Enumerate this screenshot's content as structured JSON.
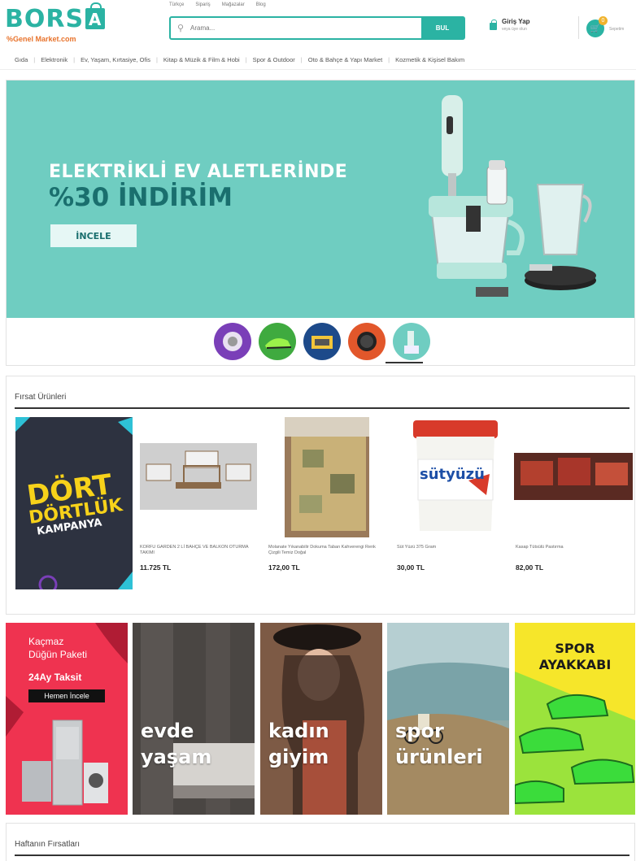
{
  "header": {
    "logo_text": "BORS",
    "logo_bag_letter": "A",
    "logo_sub": "%Genel Market.com",
    "toplinks": [
      "Türkçe",
      "Sipariş",
      "Mağazalar",
      "Blog"
    ],
    "search_placeholder": "Arama...",
    "search_button": "BUL",
    "login_main": "Giriş Yap",
    "login_sub": "veya üye olun",
    "cart_badge": "0",
    "cart_label": "Sepetim"
  },
  "nav": {
    "items": [
      "Gıda",
      "Elektronik",
      "Ev, Yaşam, Kırtasiye, Ofis",
      "Kitap & Müzik & Film & Hobi",
      "Spor & Outdoor",
      "Oto & Bahçe & Yapı Market",
      "Kozmetik & Kişisel Bakım"
    ]
  },
  "hero": {
    "line1": "ELEKTRİKLİ EV ALETLERİNDE",
    "line2": "%30 İNDİRİM",
    "button": "İNCELE",
    "thumbs": [
      "headphones",
      "shoes",
      "electronics",
      "watch",
      "blender"
    ],
    "active_thumb": 4,
    "colors": {
      "bg": "#6fcdc1",
      "accent": "#2bb3a3"
    }
  },
  "firsat": {
    "title": "Fırsat Ürünleri",
    "promo": {
      "line1": "DÖRT",
      "line2": "DÖRTLÜK",
      "line3": "KAMPANYA"
    },
    "products": [
      {
        "name": "KORFU GARDEN 2 Lİ BAHÇE VE BALKON OTURMA TAKIMI",
        "price": "11.725 TL"
      },
      {
        "name": "Molanate Yıkanabilir Dokuma Taban Kahverengi Renk Çizgili Temiz Doğal",
        "price": "172,00 TL"
      },
      {
        "name": "Süt Yüzü 375 Gram",
        "price": "30,00 TL"
      },
      {
        "name": "Kasap Tütsülü Pastırma",
        "price": "82,00 TL"
      }
    ],
    "sutyuzu_label": "sütyüzü"
  },
  "banners": {
    "dugun": {
      "line1": "Kaçmaz",
      "line2": "Düğün Paketi",
      "line3": "24Ay Taksit",
      "button": "Hemen İncele"
    },
    "evde": {
      "line1": "evde",
      "line2": "yaşam"
    },
    "kadin": {
      "line1": "kadın",
      "line2": "giyim"
    },
    "spor_urunleri": {
      "line1": "spor",
      "line2": "ürünleri"
    },
    "spor_ayakkabi": {
      "line1": "SPOR",
      "line2": "AYAKKABI"
    }
  },
  "haftanin": {
    "title": "Haftanın Fırsatları"
  }
}
